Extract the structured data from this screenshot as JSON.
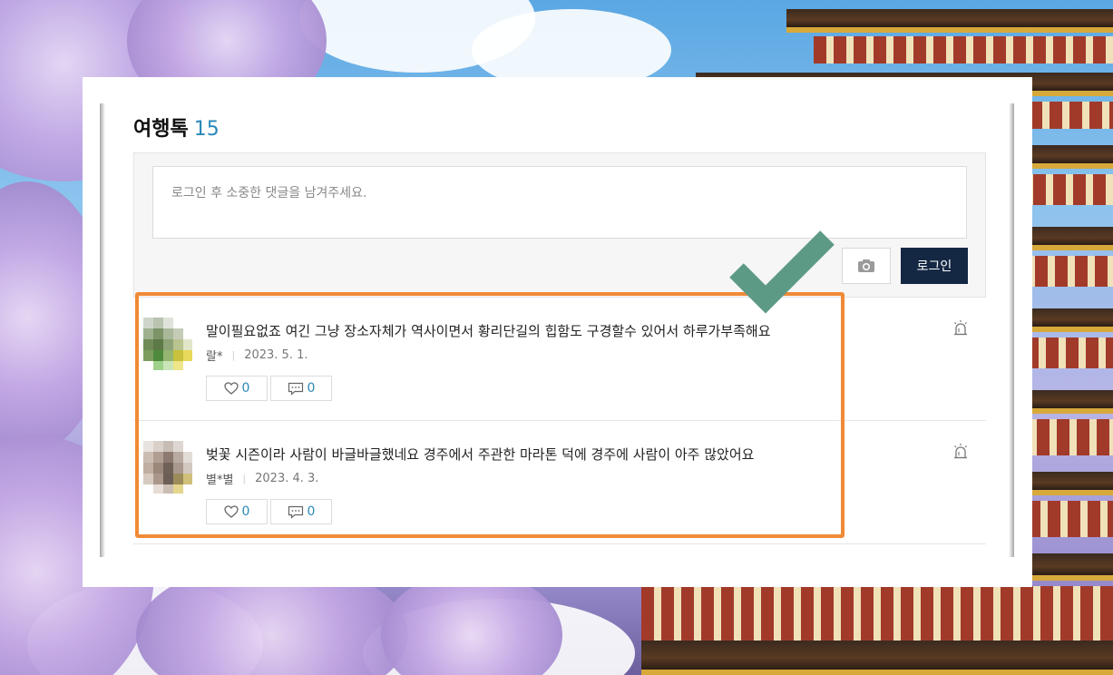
{
  "section": {
    "title": "여행톡",
    "count": "15"
  },
  "comment_form": {
    "placeholder": "로그인 후 소중한 댓글을 남겨주세요.",
    "login_label": "로그인",
    "camera_icon": "camera-icon"
  },
  "comments": [
    {
      "text": "말이필요없죠 여긴 그냥 장소자체가 역사이면서 황리단길의 힙함도 구경할수 있어서 하루가부족해요",
      "author": "랄*",
      "date": "2023. 5. 1.",
      "likes": "0",
      "replies": "0"
    },
    {
      "text": "벚꽃 시즌이라 사람이 바글바글했네요 경주에서 주관한 마라톤 덕에 경주에 사람이 아주 많았어요",
      "author": "별*별",
      "date": "2023. 4. 3.",
      "likes": "0",
      "replies": "0"
    }
  ],
  "colors": {
    "accent": "#2a88b8",
    "login_button": "#142844",
    "highlight": "#f08a36",
    "checkmark": "#5d9a86"
  },
  "icons": [
    "heart-icon",
    "speech-bubble-icon",
    "siren-report-icon",
    "camera-icon",
    "checkmark-icon"
  ]
}
